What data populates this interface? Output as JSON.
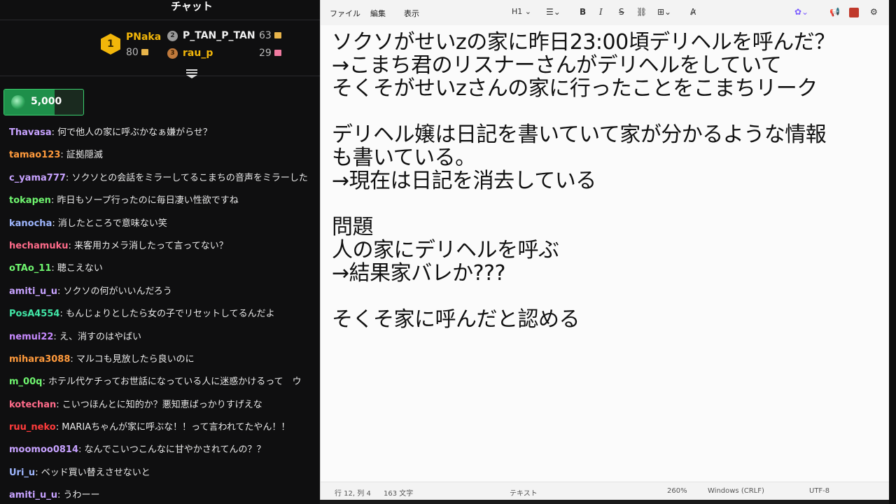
{
  "chat": {
    "title": "チャット",
    "leaderboard": {
      "first": {
        "rank": "1",
        "name": "PNaka",
        "value": "80",
        "name_color": "#f2b60a"
      },
      "second": {
        "rank": "2",
        "name": "P_TAN_P_TAN",
        "value": "63"
      },
      "third": {
        "rank": "3",
        "name": "rau_p",
        "value": "29"
      }
    },
    "points": {
      "value": "5,000",
      "fill_fraction": 0.64
    },
    "messages": [
      {
        "user": "Thavasa",
        "text": "何で他人の家に呼ぶかなぁ嫌がらせ？",
        "color": "#c7a2ff"
      },
      {
        "user": "tamao123",
        "text": "証拠隠滅",
        "color": "#ff9a3c"
      },
      {
        "user": "c_yama777",
        "text": "ソクソとの会話をミラーしてるこまちの音声をミラーした",
        "color": "#c7a2ff"
      },
      {
        "user": "tokapen",
        "text": "昨日もソープ行ったのに毎日凄い性欲ですね",
        "color": "#6ff56f"
      },
      {
        "user": "kanocha",
        "text": "消したところで意味ない笑",
        "color": "#9fb7ff"
      },
      {
        "user": "hechamuku",
        "text": "来客用カメラ消したって言ってない？",
        "color": "#ff6b8a"
      },
      {
        "user": "oTAo_11",
        "text": "聴こえない",
        "color": "#6ff56f"
      },
      {
        "user": "amiti_u_u",
        "text": "ソクソの何がいいんだろう",
        "color": "#c7a2ff"
      },
      {
        "user": "PosA4554",
        "text": "もんじょりとしたら女の子でリセットしてるんだよ",
        "color": "#41e6a6"
      },
      {
        "user": "nemui22",
        "text": "え、消すのはやばい",
        "color": "#c78aff"
      },
      {
        "user": "mihara3088",
        "text": "マルコも見放したら良いのに",
        "color": "#ff9a3c"
      },
      {
        "user": "m_00q",
        "text": "ホテル代ケチってお世話になっている人に迷惑かけるって　ウ",
        "color": "#6ff56f"
      },
      {
        "user": "kotechan",
        "text": "こいつほんとに知的か？悪知恵ばっかりすげえな",
        "color": "#ff6b8a"
      },
      {
        "user": "ruu_neko",
        "text": "MARIAちゃんが家に呼ぶな！！って言われてたやん！！",
        "color": "#ff3b3b"
      },
      {
        "user": "moomoo0814",
        "text": "なんでこいつこんなに甘やかされてんの？？",
        "color": "#c7a2ff"
      },
      {
        "user": "Uri_u",
        "text": "ベッド買い替えさせないと",
        "color": "#9fb7ff"
      },
      {
        "user": "amiti_u_u",
        "text": "うわーー",
        "color": "#c7a2ff"
      }
    ]
  },
  "notepad": {
    "menu": [
      "ファイル",
      "編集",
      "表示"
    ],
    "heading_select": "H1",
    "editor_lines": [
      "ソクソがせいzの家に昨日23:00頃デリヘルを呼んだ？",
      "→こまち君のリスナーさんがデリヘルをしていて",
      "そくそがせいzさんの家に行ったことをこまちリーク",
      "",
      "デリヘル嬢は日記を書いていて家が分かるような情報",
      "も書いている。",
      "→現在は日記を消去している",
      "",
      "問題",
      "人の家にデリヘルを呼ぶ",
      "→結果家バレか???",
      "",
      "そくそ家に呼んだと認める"
    ],
    "status": {
      "position": "行 12, 列 4",
      "chars": "163 文字",
      "format": "テキスト",
      "zoom": "260%",
      "line_ending": "Windows (CRLF)",
      "encoding": "UTF-8"
    }
  }
}
